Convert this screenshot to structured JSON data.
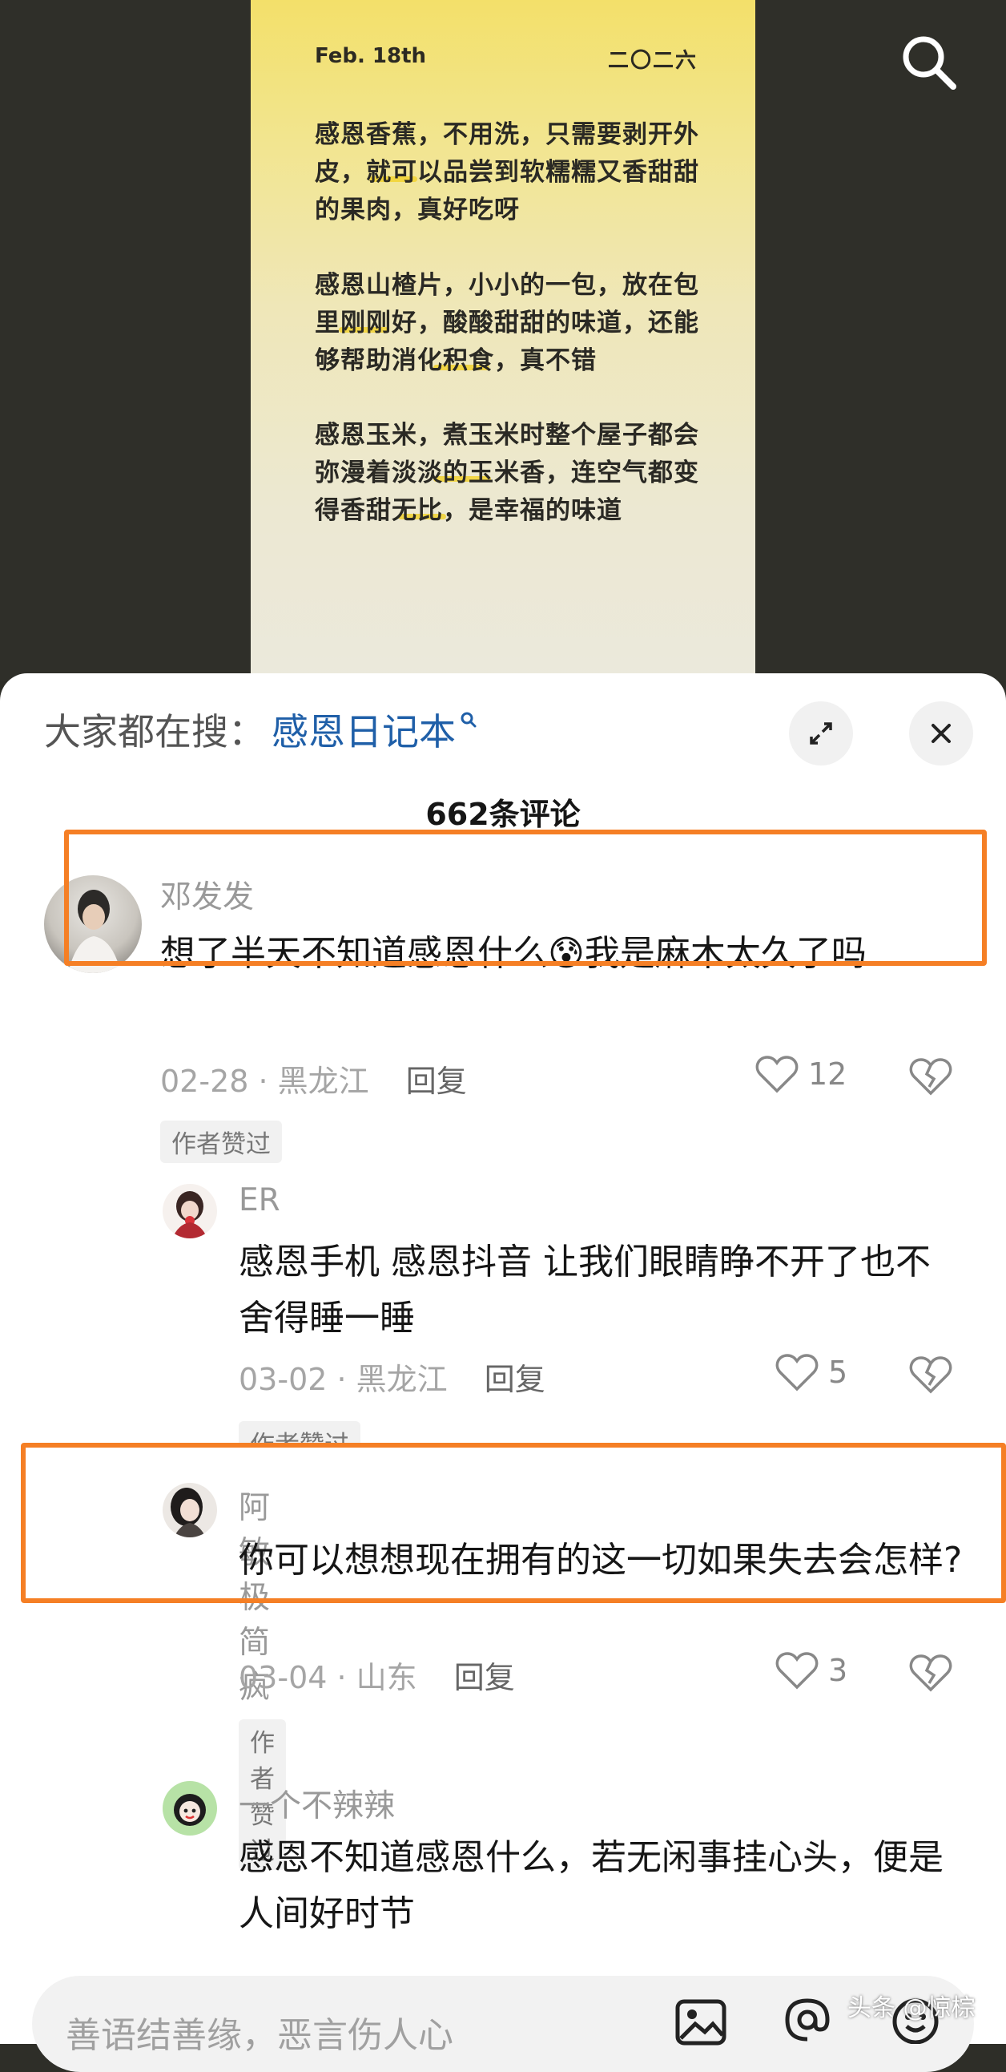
{
  "poster": {
    "date": "Feb. 18th",
    "year": "二〇二六",
    "paragraphs": [
      "感恩香蕉，不用洗，只需要剥开外皮，就可以品尝到软糯糯又香甜甜的果肉，真好吃呀",
      "感恩山楂片，小小的一包，放在包里刚刚好，酸酸甜甜的味道，还能够帮助消化积食，真不错",
      "感恩玉米，煮玉米时整个屋子都会弥漫着淡淡的玉米香，连空气都变得香甜无比，是幸福的味道"
    ]
  },
  "hot_search": {
    "label": "大家都在搜：",
    "keyword": "感恩日记本"
  },
  "comment_count": "662条评论",
  "comments": [
    {
      "user": "邓发发",
      "text": "想了半天不知道感恩什么😰我是麻木太久了吗",
      "date": "02-28",
      "location": "黑龙江",
      "reply": "回复",
      "likes": "12",
      "badge": "作者赞过"
    },
    {
      "user": "ER",
      "text": "感恩手机 感恩抖音 让我们眼睛睁不开了也不舍得睡一睡",
      "date": "03-02",
      "location": "黑龙江",
      "reply": "回复",
      "likes": "5",
      "badge": "作者赞过"
    },
    {
      "user": "阿敏极简疯",
      "text": "你可以想想现在拥有的这一切如果失去会怎样?",
      "date": "03-04",
      "location": "山东",
      "reply": "回复",
      "likes": "3",
      "badge": "作者赞过"
    },
    {
      "user": "一个不辣辣",
      "text": "感恩不知道感恩什么，若无闲事挂心头，便是人间好时节"
    }
  ],
  "input": {
    "placeholder": "善语结善缘，恶言伤人心"
  },
  "watermark": "头条 @惊棕",
  "colors": {
    "highlight_box": "#f57f25",
    "link": "#1f5fa8",
    "poster_yellow": "#f3e06a"
  },
  "icons": [
    "search-icon",
    "expand-icon",
    "close-icon",
    "heart-icon",
    "broken-heart-icon",
    "image-icon",
    "at-icon",
    "emoji-icon"
  ]
}
